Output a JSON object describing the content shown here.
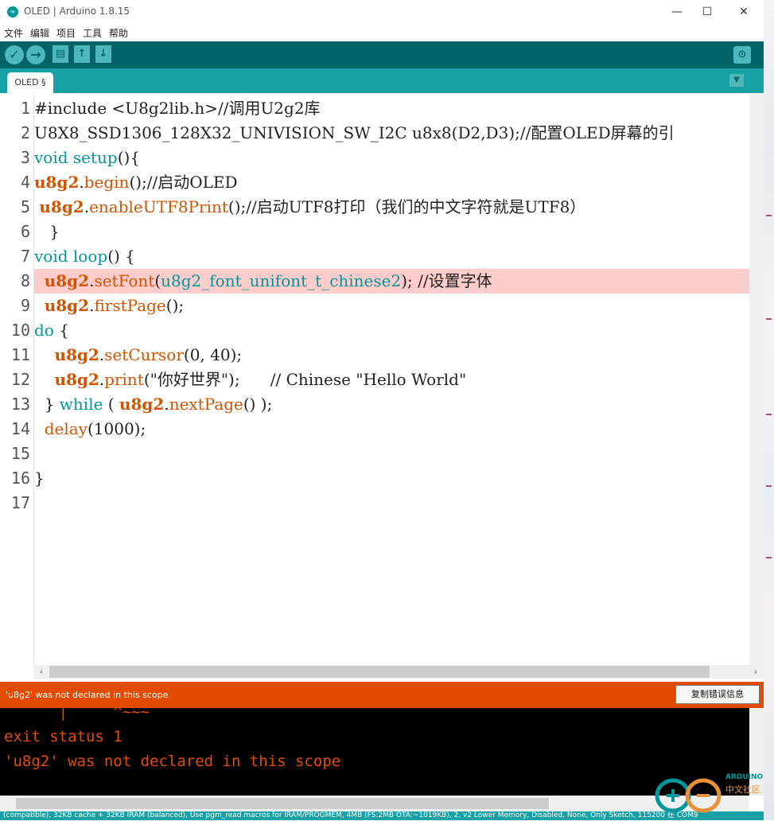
{
  "window": {
    "title": "OLED | Arduino 1.8.15",
    "minimize": "—",
    "maximize": "☐",
    "close": "✕"
  },
  "menubar": [
    "文件",
    "编辑",
    "项目",
    "工具",
    "帮助"
  ],
  "toolbar": {
    "verify_icon": "check-icon",
    "upload_icon": "arrow-right-icon",
    "new_icon": "new-file-icon",
    "open_icon": "arrow-up-icon",
    "save_icon": "arrow-down-icon",
    "serial_icon": "magnifier-icon"
  },
  "tab": {
    "label": "OLED §"
  },
  "editor": {
    "line_numbers": [
      "1",
      "2",
      "3",
      "4",
      "5",
      "6",
      "7",
      "8",
      "9",
      "10",
      "11",
      "12",
      "13",
      "14",
      "15",
      "16",
      "17"
    ],
    "highlighted_line": 8
  },
  "error": {
    "message": "'u8g2' was not declared in this scope",
    "copy_button": "复制错误信息"
  },
  "console": {
    "lines": [
      "      |     ^~~~",
      "exit status 1",
      "'u8g2' was not declared in this scope"
    ]
  },
  "status": {
    "text": "(compatible), 32KB cache + 32KB IRAM (balanced), Use pgm_read macros for IRAM/PROGMEM, 4MB (FS:2MB OTA:~1019KB), 2, v2 Lower Memory, Disabled, None, Only Sketch, 115200 在 COM9"
  },
  "watermark": {
    "line1": "ARDUINO",
    "line2": "中文社区"
  },
  "colors": {
    "toolbar": "#006468",
    "tabstrip": "#17a1a5",
    "error": "#e34c00",
    "highlight": "#ffcccc"
  }
}
